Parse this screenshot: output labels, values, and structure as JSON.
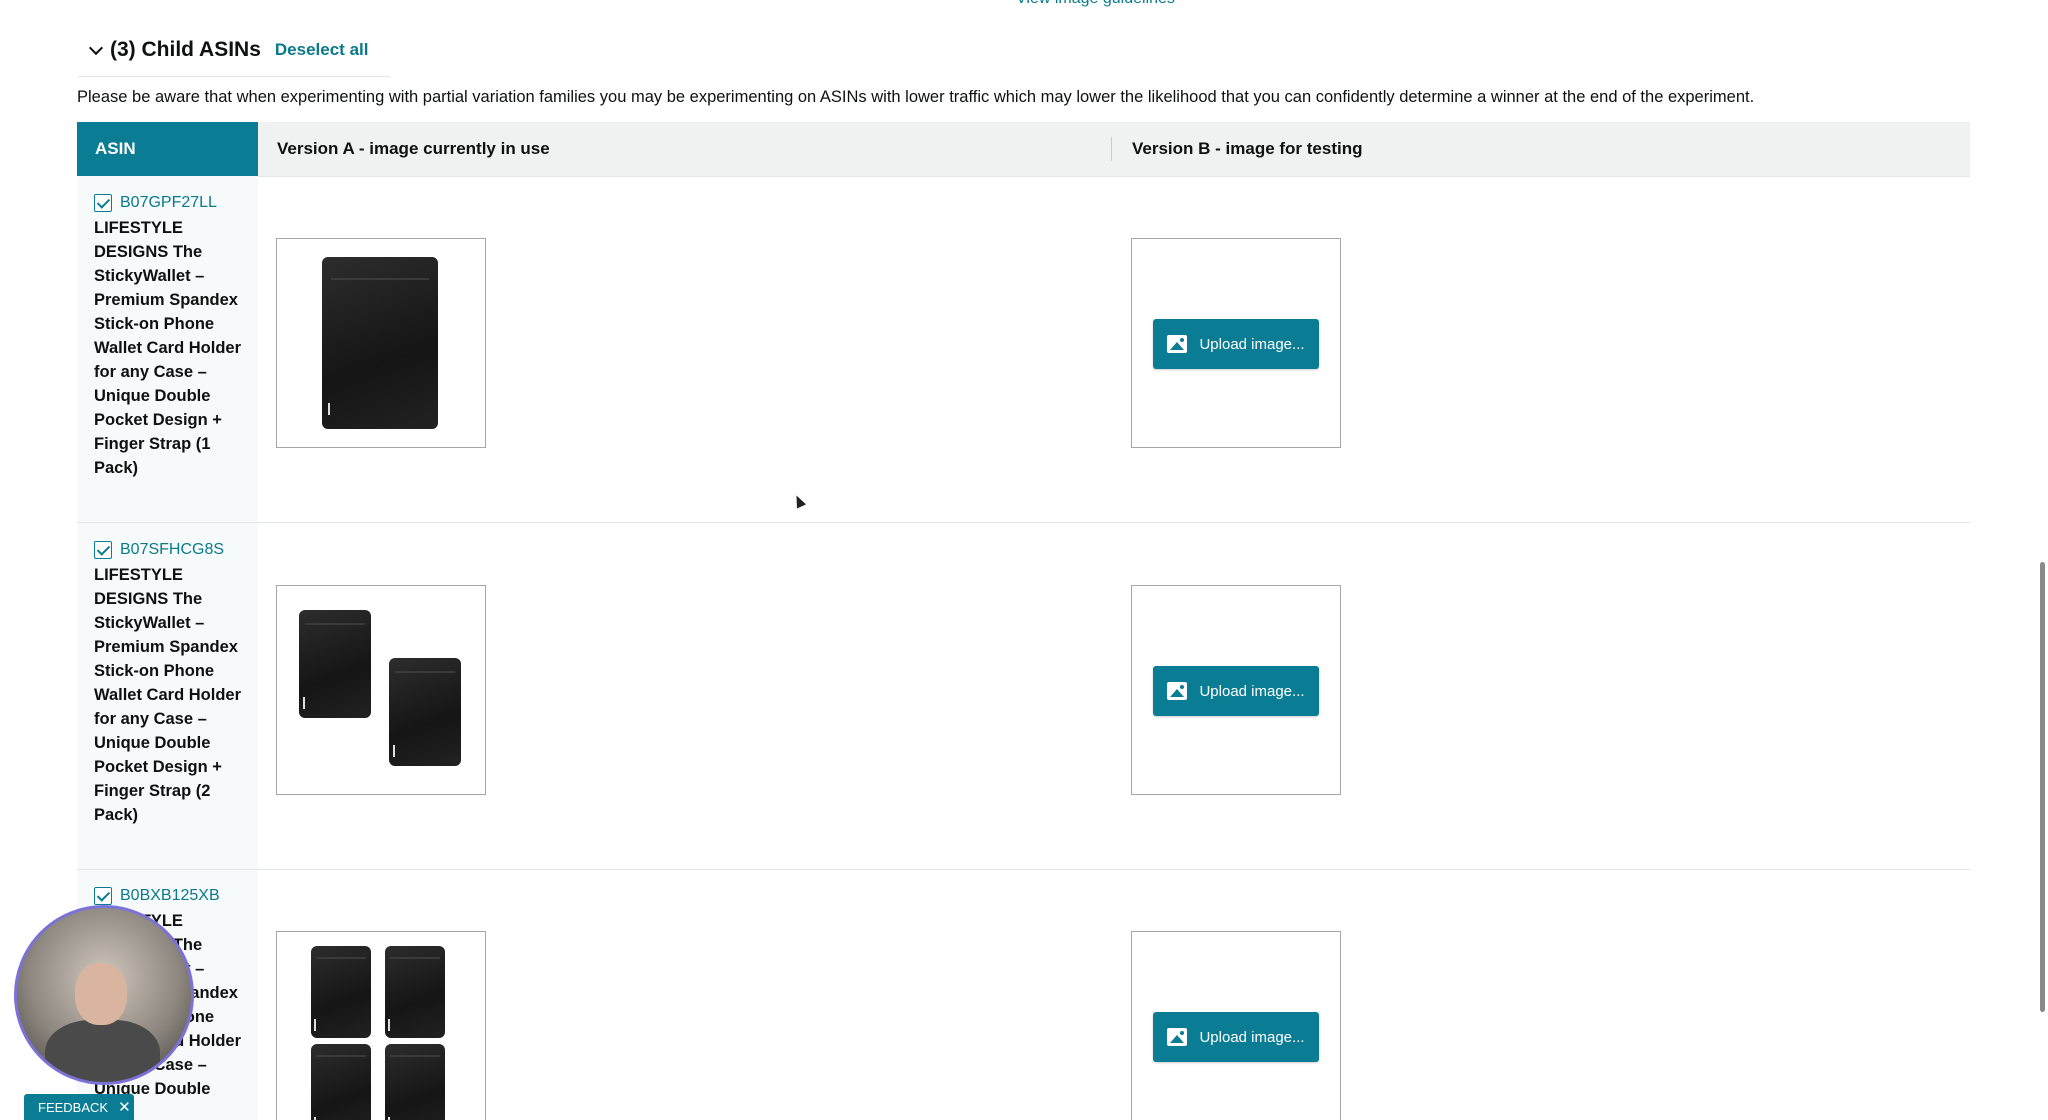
{
  "top_link": "View image guidelines",
  "section": {
    "title": "(3) Child ASINs",
    "deselect_label": "Deselect all",
    "notice": "Please be aware that when experimenting with partial variation families you may be experimenting on ASINs with lower traffic which may lower the likelihood that you can confidently determine a winner at the end of the experiment."
  },
  "table": {
    "headers": {
      "asin": "ASIN",
      "version_a": "Version A - image currently in use",
      "version_b": "Version B - image for testing"
    },
    "upload_label": "Upload image...",
    "rows": [
      {
        "asin": "B07GPF27LL",
        "checked": true,
        "title": "LIFESTYLE DESIGNS The StickyWallet – Premium Spandex Stick-on Phone Wallet Card Holder for any Case – Unique Double Pocket Design + Finger Strap (1 Pack)"
      },
      {
        "asin": "B07SFHCG8S",
        "checked": true,
        "title": "LIFESTYLE DESIGNS The StickyWallet – Premium Spandex Stick-on Phone Wallet Card Holder for any Case – Unique Double Pocket Design + Finger Strap (2 Pack)"
      },
      {
        "asin": "B0BXB125XB",
        "checked": true,
        "title": "LIFESTYLE DESIGNS The StickyWallet – Premium Spandex Stick-on Phone Wallet Card Holder for any Case – Unique Double"
      }
    ]
  },
  "feedback": {
    "label": "FEEDBACK",
    "close": "✕"
  },
  "colors": {
    "accent": "#0a7d94",
    "link": "#0a7a8a",
    "header_bg": "#f0f2f2"
  }
}
